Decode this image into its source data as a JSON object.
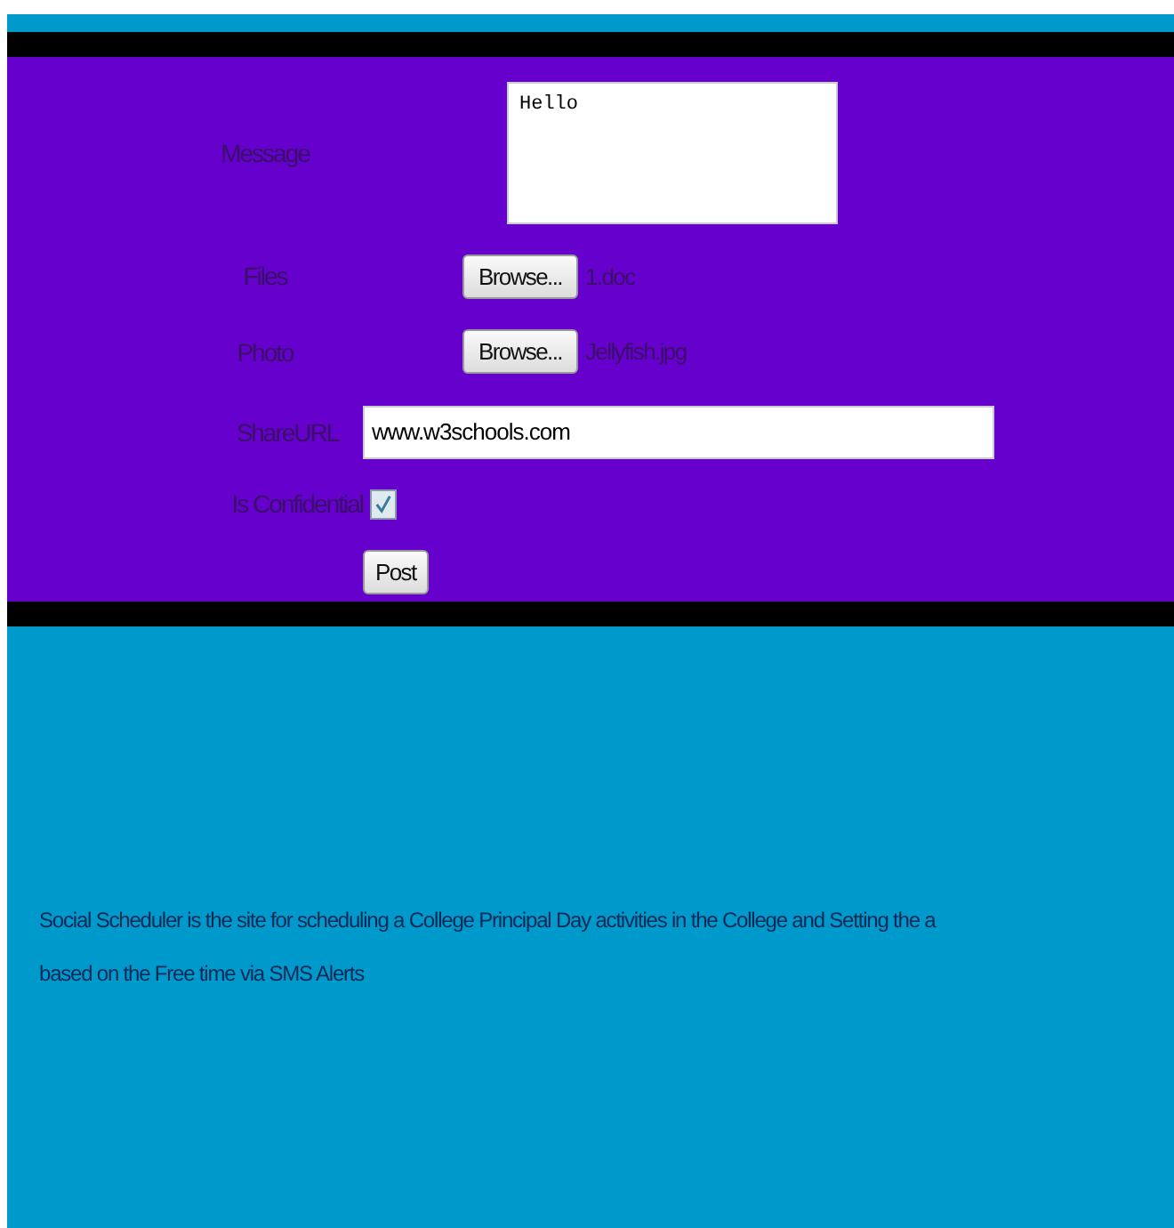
{
  "form": {
    "fields": [
      {
        "kind": "textarea",
        "label": "Message",
        "value": "Hello"
      },
      {
        "kind": "file",
        "label": "Files",
        "button": "Browse...",
        "file": "1.doc"
      },
      {
        "kind": "file",
        "label": "Photo",
        "button": "Browse...",
        "file": "Jellyfish.jpg"
      },
      {
        "kind": "text",
        "label": "ShareURL",
        "value": "www.w3schools.com"
      },
      {
        "kind": "checkbox",
        "label": "Is Confidential",
        "checked": true
      }
    ],
    "submit": "Post"
  },
  "description": [
    "Social Scheduler is the site for scheduling a College Principal Day activities in the College and Setting the a",
    "based on the Free time via SMS Alerts"
  ]
}
